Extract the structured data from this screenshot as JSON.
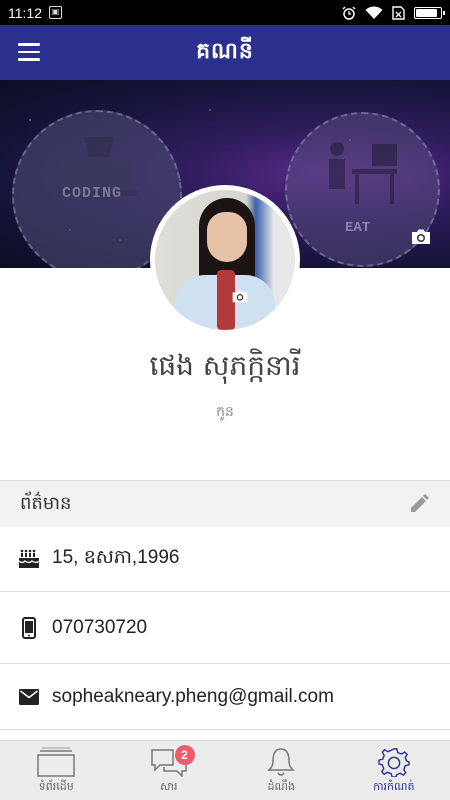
{
  "status_bar": {
    "time": "11:12",
    "notification_icon": "image-notification-icon",
    "icons": [
      "alarm-icon",
      "wifi-icon",
      "no-sim-icon",
      "battery-icon"
    ]
  },
  "app_bar": {
    "title": "គណនី",
    "menu_icon": "hamburger-menu-icon"
  },
  "cover": {
    "left_label": "CODING",
    "right_label": "EAT",
    "camera_icon": "camera-icon"
  },
  "profile": {
    "name": "ផេង សុភក្កិនារី",
    "role": "កូន"
  },
  "info": {
    "section_title": "ព័ត៌មាន",
    "edit_icon": "pencil-icon",
    "birthday": "15, ឧសភា,1996",
    "phone": "070730720",
    "email": "sopheakneary.pheng@gmail.com"
  },
  "bottom_nav": {
    "items": [
      {
        "label": "ទំព័រដើម",
        "icon": "home-icon"
      },
      {
        "label": "សារ",
        "icon": "chat-icon",
        "badge": "2"
      },
      {
        "label": "ដំណឹង",
        "icon": "bell-icon"
      },
      {
        "label": "ការកំណត់",
        "icon": "settings-icon"
      }
    ],
    "active_color": "#2b2f8e",
    "badge_color": "#f05a6b"
  },
  "colors": {
    "primary": "#2b2f8e"
  }
}
